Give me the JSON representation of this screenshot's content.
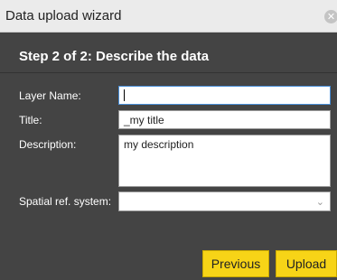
{
  "window": {
    "title": "Data upload wizard",
    "close_icon_glyph": "✕"
  },
  "step": {
    "heading": "Step 2 of 2: Describe the data"
  },
  "form": {
    "layer_name": {
      "label": "Layer Name:",
      "value": ""
    },
    "title": {
      "label": "Title:",
      "value": "_my title"
    },
    "description": {
      "label": "Description:",
      "value": "my description"
    },
    "spatial_ref": {
      "label": "Spatial ref. system:",
      "value": "",
      "chevron_glyph": "⌄"
    }
  },
  "buttons": {
    "previous": "Previous",
    "upload": "Upload"
  },
  "colors": {
    "dialog_bg": "#444444",
    "titlebar_bg": "#ebebeb",
    "button_bg": "#f7d417",
    "focus_border": "#4a90d9"
  }
}
